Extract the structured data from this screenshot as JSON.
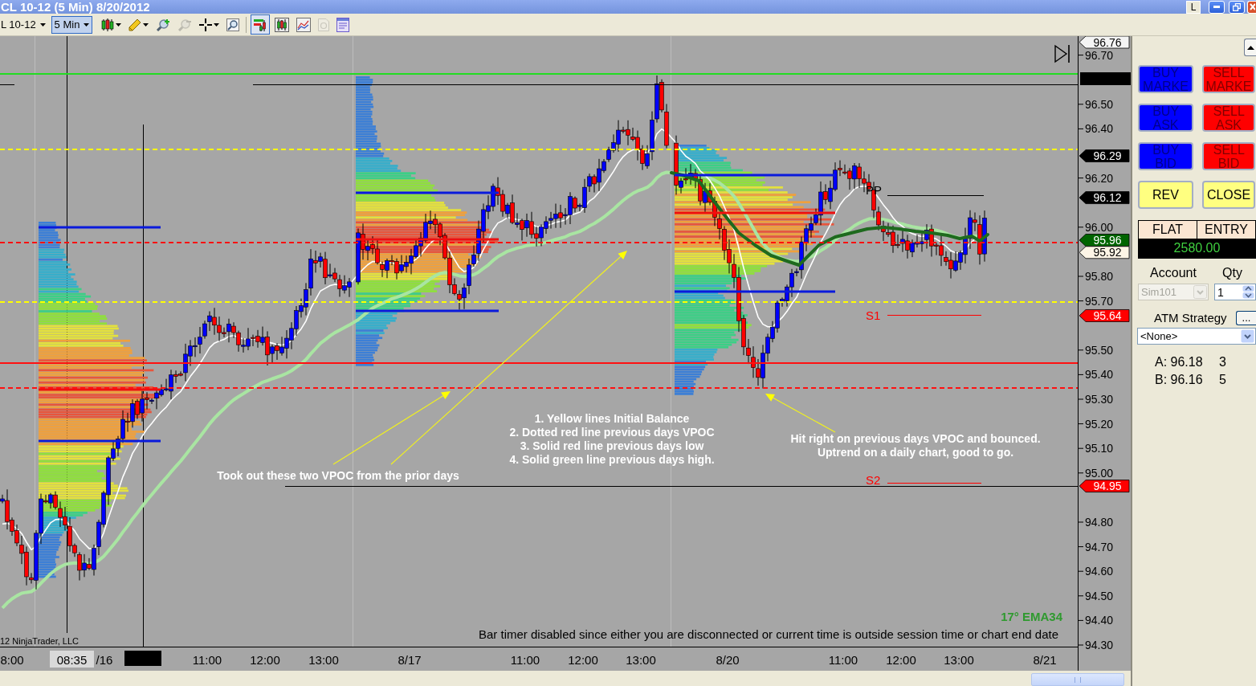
{
  "window": {
    "title": "CL 10-12 (5 Min) 8/20/2012",
    "title_button": "L"
  },
  "toolbar": {
    "instrument": "L 10-12",
    "interval": "5 Min",
    "interval_focused": true,
    "tools": [
      {
        "kind": "bar-style",
        "menu": true,
        "pressed": false,
        "disabled": false
      },
      {
        "kind": "drawing",
        "menu": true,
        "pressed": false,
        "disabled": false
      },
      {
        "kind": "zoom-in",
        "menu": false,
        "pressed": false,
        "disabled": false
      },
      {
        "kind": "zoom-out",
        "menu": false,
        "pressed": false,
        "disabled": true
      },
      {
        "kind": "cursor",
        "menu": true,
        "pressed": false,
        "disabled": false
      },
      {
        "kind": "find",
        "menu": false,
        "pressed": false,
        "disabled": false
      },
      {
        "kind": "chart-trader",
        "menu": false,
        "pressed": true,
        "disabled": false
      },
      {
        "kind": "data-box",
        "menu": false,
        "pressed": false,
        "disabled": false
      },
      {
        "kind": "indicators",
        "menu": false,
        "pressed": false,
        "disabled": false
      },
      {
        "kind": "strategies",
        "menu": false,
        "pressed": false,
        "disabled": true
      },
      {
        "kind": "properties",
        "menu": false,
        "pressed": false,
        "disabled": false
      }
    ]
  },
  "chart": {
    "price_axis": {
      "labels": [
        "96.70",
        "96.50",
        "96.40",
        "96.20",
        "96.00",
        "95.80",
        "95.70",
        "95.50",
        "95.40",
        "95.30",
        "95.20",
        "95.10",
        "95.00",
        "94.80",
        "94.70",
        "94.60",
        "94.50",
        "94.40",
        "94.30"
      ]
    },
    "price_markers": [
      {
        "text": "96.76",
        "color": "#f4f4f4"
      },
      {
        "text": "96.29",
        "color": "#000000"
      },
      {
        "text": "96.12",
        "color": "#000000"
      },
      {
        "text": "95.96",
        "color": "#006400"
      },
      {
        "text": "95.92",
        "color": "#fdf5e6"
      },
      {
        "text": "95.64",
        "color": "#ff0000"
      },
      {
        "text": "94.95",
        "color": "#ff0000"
      }
    ],
    "levels": [
      {
        "label": "PP",
        "color": "#000000"
      },
      {
        "label": "S1",
        "color": "#ff0000"
      },
      {
        "label": "S2",
        "color": "#ff0000"
      }
    ],
    "annotations": [
      {
        "lines": [
          "Took out these two VPOC from the prior days"
        ]
      },
      {
        "lines": [
          "1. Yellow lines Initial Balance",
          "2. Dotted red line previous days VPOC",
          "3. Solid red line previous days low",
          "4. Solid green line previous days high."
        ]
      },
      {
        "lines": [
          "Hit right on previous days VPOC and bounced.",
          "Uptrend on a daily chart, good to go."
        ]
      }
    ],
    "indicator_label": "17° EMA34",
    "status_text": "Bar timer disabled since either you are disconnected or current time is outside session time or chart end date",
    "copyright": "12 NinjaTrader, LLC",
    "time_axis": {
      "cursor_time": "08:35",
      "labels": [
        "8:00",
        "/16",
        "11:00",
        "12:00",
        "13:00",
        "8/17",
        "11:00",
        "12:00",
        "13:00",
        "8/20",
        "11:00",
        "12:00",
        "13:00",
        "8/21"
      ]
    }
  },
  "chart_trader": {
    "buttons": [
      {
        "label": "BUY MARKE",
        "kind": "buy"
      },
      {
        "label": "SELL MARKE",
        "kind": "sell"
      },
      {
        "label": "BUY ASK",
        "kind": "buy"
      },
      {
        "label": "SELL ASK",
        "kind": "sell"
      },
      {
        "label": "BUY BID",
        "kind": "buy"
      },
      {
        "label": "SELL BID",
        "kind": "sell"
      },
      {
        "label": "REV",
        "kind": "action"
      },
      {
        "label": "CLOSE",
        "kind": "action"
      }
    ],
    "position": {
      "status": "FLAT",
      "entry": "ENTRY",
      "pnl": "2580.00"
    },
    "account": {
      "label": "Account",
      "value": "Sim101",
      "disabled": true
    },
    "quantity": {
      "label": "Qty",
      "value": "1"
    },
    "atm_strategy": {
      "label": "ATM Strategy",
      "button": "...",
      "value": "<None>"
    },
    "quotes": [
      {
        "side": "A:",
        "price": "96.18",
        "size": "3"
      },
      {
        "side": "B:",
        "price": "96.16",
        "size": "5"
      }
    ]
  }
}
